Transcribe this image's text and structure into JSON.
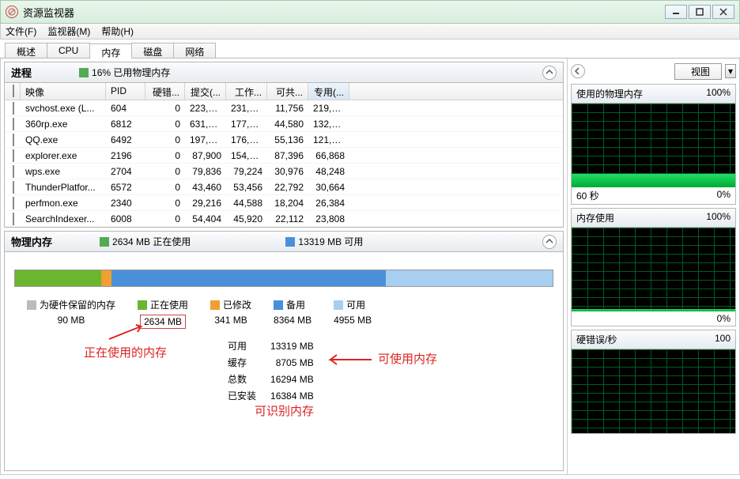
{
  "title": "资源监视器",
  "menu": {
    "file": "文件(F)",
    "monitor": "监视器(M)",
    "help": "帮助(H)"
  },
  "tabs": {
    "overview": "概述",
    "cpu": "CPU",
    "memory": "内存",
    "disk": "磁盘",
    "network": "网络"
  },
  "proc_panel": {
    "title": "进程",
    "stat": "16% 已用物理内存",
    "cols": {
      "image": "映像",
      "pid": "PID",
      "hard": "硬错...",
      "commit": "提交(...",
      "work": "工作...",
      "share": "可共...",
      "priv": "专用(..."
    },
    "rows": [
      {
        "img": "svchost.exe (L...",
        "pid": "604",
        "hd": "0",
        "cm": "223,2...",
        "wk": "231,0...",
        "sh": "11,756",
        "pr": "219,2..."
      },
      {
        "img": "360rp.exe",
        "pid": "6812",
        "hd": "0",
        "cm": "631,2...",
        "wk": "177,4...",
        "sh": "44,580",
        "pr": "132,8..."
      },
      {
        "img": "QQ.exe",
        "pid": "6492",
        "hd": "0",
        "cm": "197,8...",
        "wk": "176,9...",
        "sh": "55,136",
        "pr": "121,7..."
      },
      {
        "img": "explorer.exe",
        "pid": "2196",
        "hd": "0",
        "cm": "87,900",
        "wk": "154,2...",
        "sh": "87,396",
        "pr": "66,868"
      },
      {
        "img": "wps.exe",
        "pid": "2704",
        "hd": "0",
        "cm": "79,836",
        "wk": "79,224",
        "sh": "30,976",
        "pr": "48,248"
      },
      {
        "img": "ThunderPlatfor...",
        "pid": "6572",
        "hd": "0",
        "cm": "43,460",
        "wk": "53,456",
        "sh": "22,792",
        "pr": "30,664"
      },
      {
        "img": "perfmon.exe",
        "pid": "2340",
        "hd": "0",
        "cm": "29,216",
        "wk": "44,588",
        "sh": "18,204",
        "pr": "26,384"
      },
      {
        "img": "SearchIndexer...",
        "pid": "6008",
        "hd": "0",
        "cm": "54,404",
        "wk": "45,920",
        "sh": "22,112",
        "pr": "23,808"
      }
    ]
  },
  "phys_panel": {
    "title": "物理内存",
    "stat1": "2634 MB 正在使用",
    "stat2": "13319 MB 可用",
    "legend": {
      "reserved": {
        "label": "为硬件保留的内存",
        "value": "90 MB"
      },
      "inuse": {
        "label": "正在使用",
        "value": "2634 MB"
      },
      "modified": {
        "label": "已修改",
        "value": "341 MB"
      },
      "standby": {
        "label": "备用",
        "value": "8364 MB"
      },
      "free": {
        "label": "可用",
        "value": "4955 MB"
      }
    },
    "info": {
      "avail_l": "可用",
      "avail_v": "13319 MB",
      "cache_l": "缓存",
      "cache_v": "8705 MB",
      "total_l": "总数",
      "total_v": "16294 MB",
      "inst_l": "已安装",
      "inst_v": "16384 MB"
    }
  },
  "ann": {
    "a1": "正在使用的内存",
    "a2": "可识别内存",
    "a3": "可使用内存"
  },
  "right": {
    "view_btn": "视图",
    "g1": {
      "title": "使用的物理内存",
      "max": "100%",
      "footL": "60 秒",
      "footR": "0%"
    },
    "g2": {
      "title": "内存使用",
      "max": "100%",
      "footR": "0%"
    },
    "g3": {
      "title": "硬错误/秒",
      "max": "100"
    }
  }
}
